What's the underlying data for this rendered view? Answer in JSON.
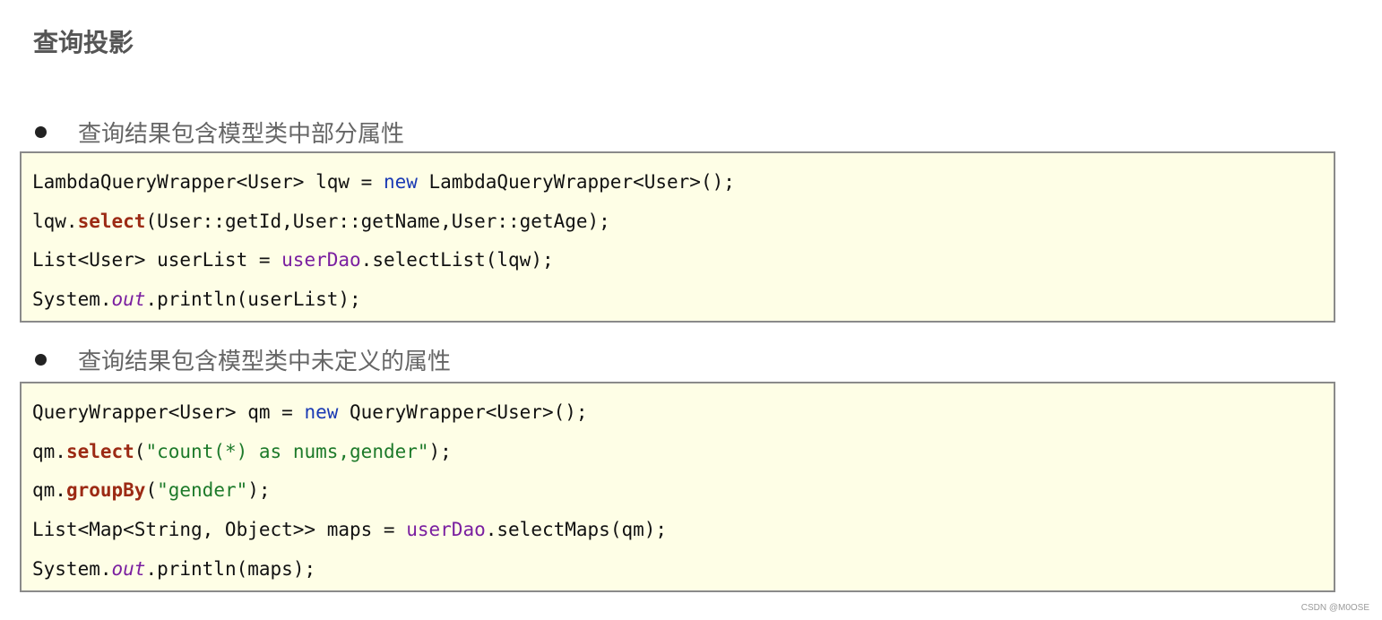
{
  "page": {
    "title": "查询投影",
    "watermark": "CSDN @M0OSE"
  },
  "sections": [
    {
      "bullet": "查询结果包含模型类中部分属性",
      "code": [
        [
          {
            "t": "LambdaQueryWrapper<User> lqw = ",
            "s": "plain"
          },
          {
            "t": "new",
            "s": "keyword"
          },
          {
            "t": " LambdaQueryWrapper<User>();",
            "s": "plain"
          }
        ],
        [
          {
            "t": "lqw.",
            "s": "plain"
          },
          {
            "t": "select",
            "s": "method"
          },
          {
            "t": "(User::getId,User::getName,User::getAge);",
            "s": "plain"
          }
        ],
        [
          {
            "t": "List<User> userList = ",
            "s": "plain"
          },
          {
            "t": "userDao",
            "s": "field"
          },
          {
            "t": ".selectList(lqw);",
            "s": "plain"
          }
        ],
        [
          {
            "t": "System.",
            "s": "plain"
          },
          {
            "t": "out",
            "s": "static"
          },
          {
            "t": ".println(userList);",
            "s": "plain"
          }
        ]
      ]
    },
    {
      "bullet": "查询结果包含模型类中未定义的属性",
      "code": [
        [
          {
            "t": "QueryWrapper<User> qm = ",
            "s": "plain"
          },
          {
            "t": "new",
            "s": "keyword"
          },
          {
            "t": " QueryWrapper<User>();",
            "s": "plain"
          }
        ],
        [
          {
            "t": "qm.",
            "s": "plain"
          },
          {
            "t": "select",
            "s": "method"
          },
          {
            "t": "(",
            "s": "plain"
          },
          {
            "t": "\"count(*) as nums,gender\"",
            "s": "string"
          },
          {
            "t": ");",
            "s": "plain"
          }
        ],
        [
          {
            "t": "qm.",
            "s": "plain"
          },
          {
            "t": "groupBy",
            "s": "method"
          },
          {
            "t": "(",
            "s": "plain"
          },
          {
            "t": "\"gender\"",
            "s": "string"
          },
          {
            "t": ");",
            "s": "plain"
          }
        ],
        [
          {
            "t": "List<Map<String, Object>> maps = ",
            "s": "plain"
          },
          {
            "t": "userDao",
            "s": "field"
          },
          {
            "t": ".selectMaps(qm);",
            "s": "plain"
          }
        ],
        [
          {
            "t": "System.",
            "s": "plain"
          },
          {
            "t": "out",
            "s": "static"
          },
          {
            "t": ".println(maps);",
            "s": "plain"
          }
        ]
      ]
    }
  ]
}
